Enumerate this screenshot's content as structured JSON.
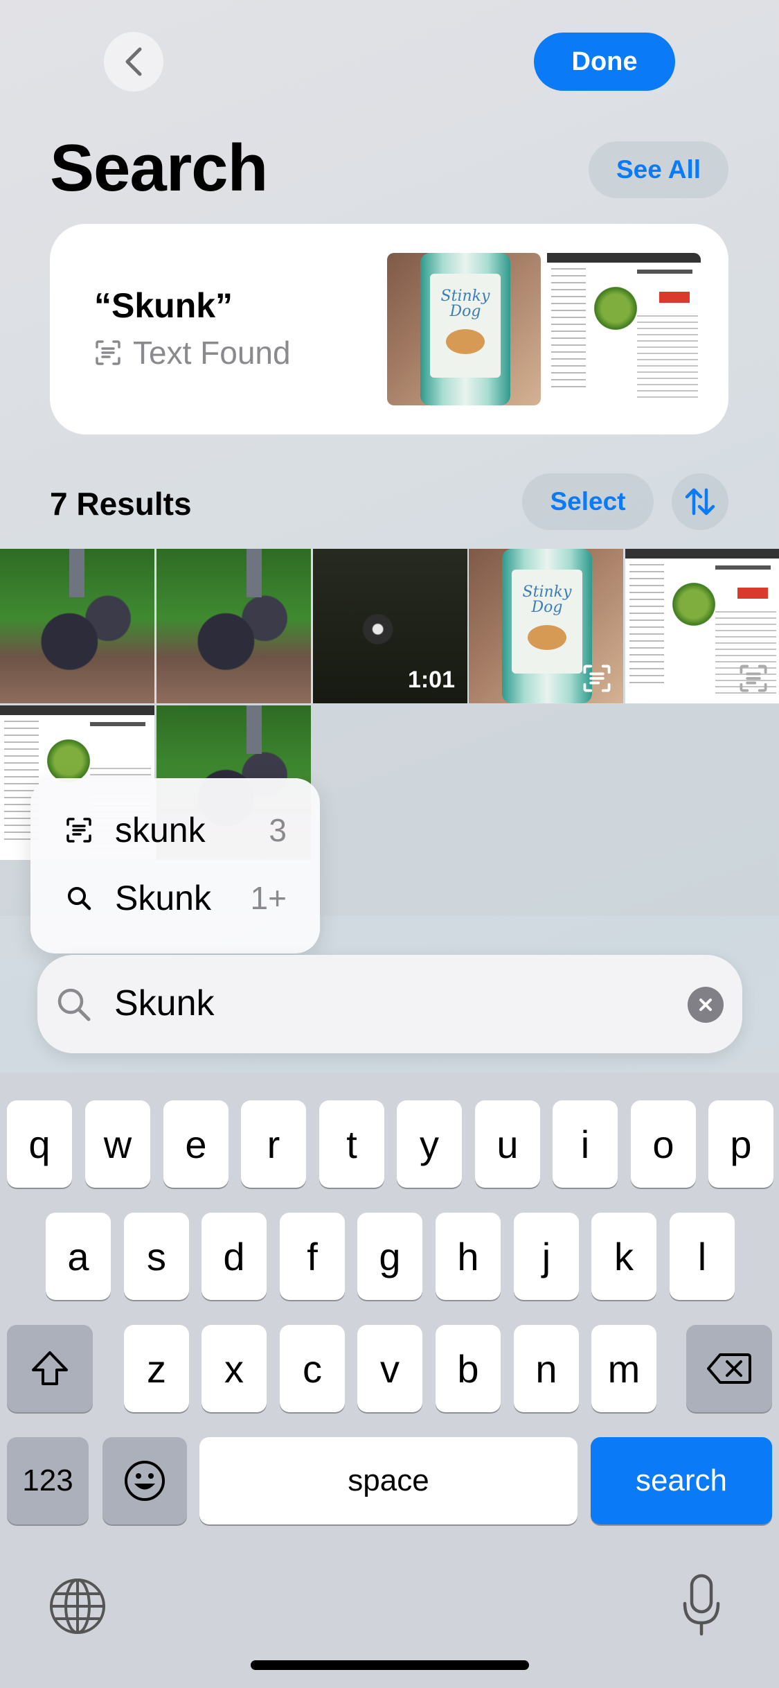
{
  "header": {
    "done_label": "Done",
    "title": "Search",
    "see_all_label": "See All"
  },
  "top_result": {
    "query": "“Skunk”",
    "subtitle": "Text Found"
  },
  "results": {
    "count_label": "7 Results",
    "select_label": "Select",
    "video_duration": "1:01"
  },
  "bottle_label_text": "Stinky Dog",
  "suggestions": [
    {
      "icon": "text-recognition-icon",
      "label": "skunk",
      "count": "3"
    },
    {
      "icon": "search-icon",
      "label": "Skunk",
      "count": "1+"
    }
  ],
  "search": {
    "value": "Skunk"
  },
  "keyboard": {
    "row1": [
      "q",
      "w",
      "e",
      "r",
      "t",
      "y",
      "u",
      "i",
      "o",
      "p"
    ],
    "row2": [
      "a",
      "s",
      "d",
      "f",
      "g",
      "h",
      "j",
      "k",
      "l"
    ],
    "row3": [
      "z",
      "x",
      "c",
      "v",
      "b",
      "n",
      "m"
    ],
    "numbers_label": "123",
    "space_label": "space",
    "search_label": "search"
  },
  "colors": {
    "accent": "#0a7af6",
    "keyboard_bg": "#d0d3d9"
  }
}
